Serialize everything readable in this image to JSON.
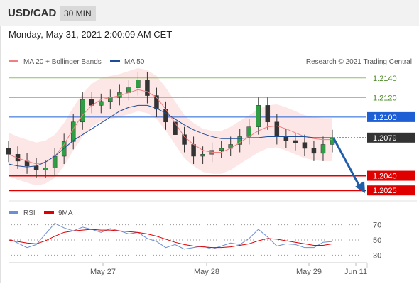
{
  "header": {
    "symbol": "USD/CAD",
    "timeframe": "30 MIN",
    "datetime": "Monday, May 31, 2021 2:00:09 AM CET"
  },
  "legend": {
    "ma20_label": "MA 20 + Bollinger Bands",
    "ma50_label": "MA 50",
    "credit": "Research © 2021 Trading Central",
    "rsi_label": "RSI",
    "ma9_label": "9MA"
  },
  "colors": {
    "ma20": "#f08080",
    "ma50": "#1f4e99",
    "bollinger": "#fde0e0",
    "resistance_green": "#90c060",
    "blue_level": "#1f5fd6",
    "red_level": "#e00000",
    "current": "#333333",
    "arrow": "#1f5ea8",
    "rsi": "#6b8fd4",
    "rsi_ma": "#e00000"
  },
  "chart_data": [
    {
      "type": "candlestick",
      "title": "USD/CAD",
      "ylim": [
        1.2015,
        1.215
      ],
      "levels": [
        {
          "value": 1.214,
          "label": "1.2140",
          "style": "green"
        },
        {
          "value": 1.212,
          "label": "1.2120",
          "style": "green"
        },
        {
          "value": 1.21,
          "label": "1.2100",
          "style": "blue"
        },
        {
          "value": 1.2079,
          "label": "1.2079",
          "style": "current"
        },
        {
          "value": 1.204,
          "label": "1.2040",
          "style": "red"
        },
        {
          "value": 1.2025,
          "label": "1.2025",
          "style": "red"
        }
      ],
      "x_ticks": [
        "May 27",
        "May 28",
        "May 29",
        "Jun 11"
      ],
      "series": [
        {
          "name": "MA 20 + Bollinger Bands",
          "values": [
            1.2062,
            1.2058,
            1.2055,
            1.2052,
            1.2054,
            1.206,
            1.2072,
            1.2088,
            1.2102,
            1.2112,
            1.2118,
            1.212,
            1.2122,
            1.2125,
            1.2128,
            1.2126,
            1.212,
            1.2108,
            1.2094,
            1.208,
            1.2072,
            1.2066,
            1.2064,
            1.2064,
            1.2068,
            1.2074,
            1.208,
            1.2086,
            1.209,
            1.2091,
            1.2088,
            1.2084,
            1.208,
            1.2078,
            1.2077,
            1.2077
          ]
        },
        {
          "name": "MA 50",
          "values": [
            1.2052,
            1.205,
            1.2049,
            1.205,
            1.2054,
            1.206,
            1.2068,
            1.2076,
            1.2082,
            1.2088,
            1.2094,
            1.21,
            1.2106,
            1.211,
            1.2112,
            1.2112,
            1.2109,
            1.2104,
            1.2098,
            1.2092,
            1.2087,
            1.2083,
            1.208,
            1.2078,
            1.2078,
            1.2078,
            1.2079,
            1.2079,
            1.208,
            1.208,
            1.208,
            1.208,
            1.208,
            1.2079,
            1.2079,
            1.2079
          ]
        }
      ],
      "closes": [
        1.2062,
        1.2055,
        1.205,
        1.2046,
        1.2048,
        1.206,
        1.2075,
        1.2095,
        1.2118,
        1.2112,
        1.2116,
        1.212,
        1.2125,
        1.213,
        1.2138,
        1.2122,
        1.2108,
        1.2095,
        1.2082,
        1.2072,
        1.206,
        1.2062,
        1.2066,
        1.2068,
        1.2072,
        1.208,
        1.209,
        1.2112,
        1.2095,
        1.208,
        1.2076,
        1.2074,
        1.2068,
        1.2063,
        1.2072,
        1.2079
      ]
    },
    {
      "type": "line",
      "title": "RSI",
      "ylim": [
        20,
        80
      ],
      "y_ticks": [
        70,
        50,
        30
      ],
      "series": [
        {
          "name": "RSI",
          "values": [
            52,
            46,
            40,
            44,
            58,
            72,
            66,
            62,
            67,
            64,
            60,
            65,
            62,
            58,
            60,
            52,
            48,
            40,
            44,
            38,
            40,
            42,
            38,
            42,
            46,
            44,
            52,
            64,
            54,
            42,
            45,
            44,
            40,
            40,
            47,
            48
          ]
        },
        {
          "name": "9MA",
          "values": [
            50,
            48,
            46,
            45,
            49,
            55,
            60,
            62,
            63,
            64,
            63,
            63,
            62,
            61,
            60,
            58,
            55,
            51,
            47,
            44,
            42,
            41,
            40,
            40,
            41,
            43,
            45,
            49,
            52,
            51,
            49,
            47,
            45,
            43,
            43,
            45
          ]
        }
      ]
    }
  ]
}
